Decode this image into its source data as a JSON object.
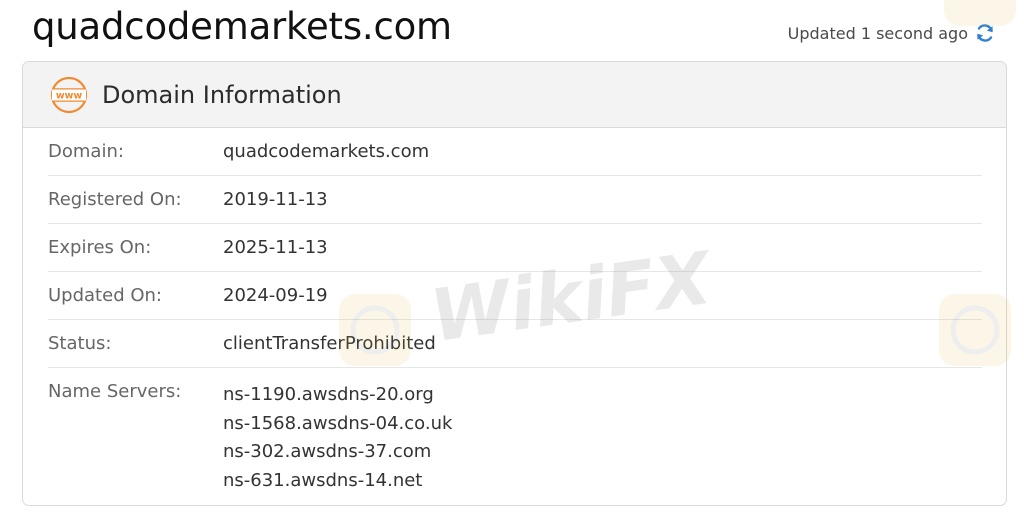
{
  "header": {
    "domain_title": "quadcodemarkets.com",
    "updated_text": "Updated 1 second ago",
    "refresh_icon": "refresh-icon"
  },
  "card": {
    "icon": "www-icon",
    "title": "Domain Information",
    "rows": [
      {
        "label": "Domain:",
        "value": "quadcodemarkets.com"
      },
      {
        "label": "Registered On:",
        "value": "2019-11-13"
      },
      {
        "label": "Expires On:",
        "value": "2025-11-13"
      },
      {
        "label": "Updated On:",
        "value": "2024-09-19"
      },
      {
        "label": "Status:",
        "value": "clientTransferProhibited"
      }
    ],
    "name_servers": {
      "label": "Name Servers:",
      "values": [
        "ns-1190.awsdns-20.org",
        "ns-1568.awsdns-04.co.uk",
        "ns-302.awsdns-37.com",
        "ns-631.awsdns-14.net"
      ]
    }
  },
  "watermark": {
    "text": "WikiFX"
  },
  "colors": {
    "accent_orange": "#f08a2e",
    "refresh_blue": "#2f7fd6",
    "header_bg": "#f3f3f3"
  }
}
